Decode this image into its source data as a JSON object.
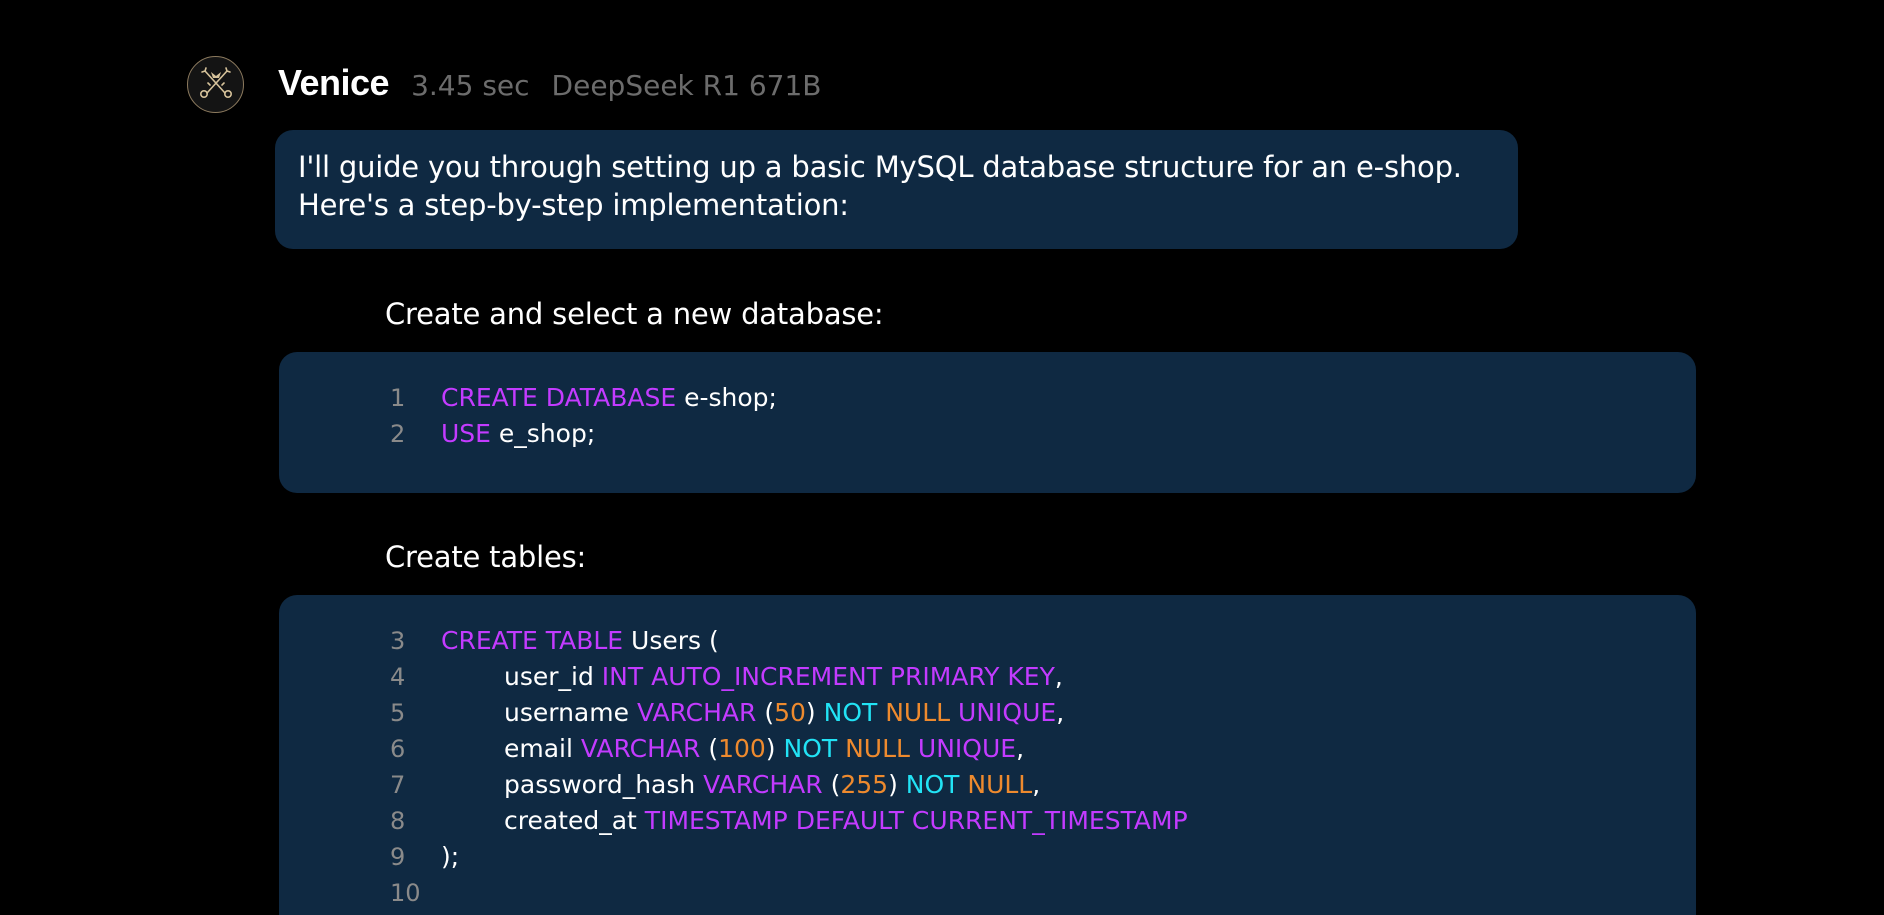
{
  "message": {
    "sender": "Venice",
    "response_time": "3.45 sec",
    "model": "DeepSeek R1 671B",
    "avatar_icon": "crossed-keys-icon",
    "intro": "I'll guide you through setting up a basic MySQL database structure for an e-shop. Here's a step-by-step implementation:"
  },
  "sections": [
    {
      "heading": "Create and select a new database:",
      "lines": [
        {
          "number": "1",
          "indent": 0,
          "tokens": [
            {
              "text": "CREATE DATABASE",
              "type": "kw"
            },
            {
              "text": " e-shop;",
              "type": "plain"
            }
          ]
        },
        {
          "number": "2",
          "indent": 0,
          "tokens": [
            {
              "text": "USE",
              "type": "kw"
            },
            {
              "text": " e_shop;",
              "type": "plain"
            }
          ]
        }
      ]
    },
    {
      "heading": "Create tables:",
      "lines": [
        {
          "number": "3",
          "indent": 0,
          "tokens": [
            {
              "text": "CREATE TABLE",
              "type": "kw"
            },
            {
              "text": " Users (",
              "type": "plain"
            }
          ]
        },
        {
          "number": "4",
          "indent": 1,
          "tokens": [
            {
              "text": "user_id ",
              "type": "plain"
            },
            {
              "text": "INT AUTO_INCREMENT PRIMARY KEY",
              "type": "kw"
            },
            {
              "text": ",",
              "type": "plain"
            }
          ]
        },
        {
          "number": "5",
          "indent": 1,
          "tokens": [
            {
              "text": "username ",
              "type": "plain"
            },
            {
              "text": "VARCHAR",
              "type": "kw"
            },
            {
              "text": " (",
              "type": "plain"
            },
            {
              "text": "50",
              "type": "num"
            },
            {
              "text": ") ",
              "type": "plain"
            },
            {
              "text": "NOT",
              "type": "cy"
            },
            {
              "text": " ",
              "type": "plain"
            },
            {
              "text": "NULL",
              "type": "or"
            },
            {
              "text": " ",
              "type": "plain"
            },
            {
              "text": "UNIQUE",
              "type": "kw"
            },
            {
              "text": ",",
              "type": "plain"
            }
          ]
        },
        {
          "number": "6",
          "indent": 1,
          "tokens": [
            {
              "text": "email ",
              "type": "plain"
            },
            {
              "text": "VARCHAR",
              "type": "kw"
            },
            {
              "text": " (",
              "type": "plain"
            },
            {
              "text": "100",
              "type": "num"
            },
            {
              "text": ") ",
              "type": "plain"
            },
            {
              "text": "NOT",
              "type": "cy"
            },
            {
              "text": " ",
              "type": "plain"
            },
            {
              "text": "NULL",
              "type": "or"
            },
            {
              "text": " ",
              "type": "plain"
            },
            {
              "text": "UNIQUE",
              "type": "kw"
            },
            {
              "text": ",",
              "type": "plain"
            }
          ]
        },
        {
          "number": "7",
          "indent": 1,
          "tokens": [
            {
              "text": "password_hash ",
              "type": "plain"
            },
            {
              "text": "VARCHAR",
              "type": "kw"
            },
            {
              "text": " (",
              "type": "plain"
            },
            {
              "text": "255",
              "type": "num"
            },
            {
              "text": ") ",
              "type": "plain"
            },
            {
              "text": "NOT",
              "type": "cy"
            },
            {
              "text": " ",
              "type": "plain"
            },
            {
              "text": "NULL",
              "type": "or"
            },
            {
              "text": ",",
              "type": "plain"
            }
          ]
        },
        {
          "number": "8",
          "indent": 1,
          "tokens": [
            {
              "text": "created_at ",
              "type": "plain"
            },
            {
              "text": "TIMESTAMP DEFAULT CURRENT_TIMESTAMP",
              "type": "kw"
            }
          ]
        },
        {
          "number": "9",
          "indent": 0,
          "tokens": [
            {
              "text": ");",
              "type": "plain"
            }
          ]
        },
        {
          "number": "10",
          "indent": 0,
          "tokens": []
        }
      ]
    }
  ],
  "colors": {
    "background": "#000000",
    "bubble": "#0f2942",
    "keyword": "#c33bff",
    "number": "#ee8a2e",
    "not": "#22e3f5",
    "null": "#ee8a2e",
    "meta_text": "#6c6c6c",
    "line_number": "#8a8a8a"
  }
}
